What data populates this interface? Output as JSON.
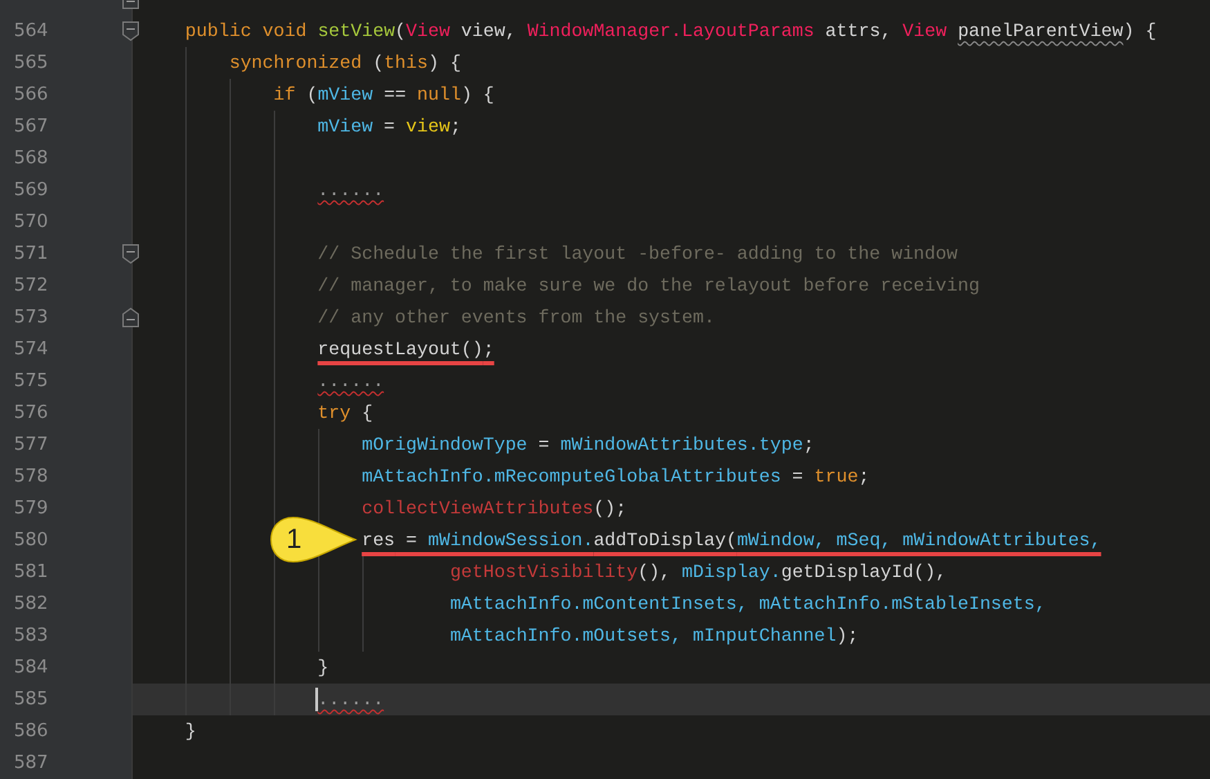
{
  "editor": {
    "lines": [
      {
        "fold_close": true
      },
      {
        "number": "564",
        "fold_open": true,
        "tokens": [
          {
            "kind": "keyword",
            "text": "    public void "
          },
          {
            "kind": "declaration",
            "text": "setView"
          },
          {
            "kind": "plain",
            "text": "("
          },
          {
            "kind": "type",
            "text": "View"
          },
          {
            "kind": "plain",
            "text": " view"
          },
          {
            "kind": "punct",
            "text": ", "
          },
          {
            "kind": "type",
            "text": "WindowManager.LayoutParams"
          },
          {
            "kind": "plain",
            "text": " attrs"
          },
          {
            "kind": "punct",
            "text": ", "
          },
          {
            "kind": "type",
            "text": "View "
          },
          {
            "kind": "plain",
            "text": "panelParentView",
            "unused": true
          },
          {
            "kind": "plain",
            "text": ") {"
          }
        ]
      },
      {
        "number": "565",
        "tokens": [
          {
            "kind": "keyword",
            "text": "        synchronized "
          },
          {
            "kind": "plain",
            "text": "("
          },
          {
            "kind": "keyword",
            "text": "this"
          },
          {
            "kind": "plain",
            "text": ") {"
          }
        ]
      },
      {
        "number": "566",
        "tokens": [
          {
            "kind": "keyword",
            "text": "            if "
          },
          {
            "kind": "plain",
            "text": "("
          },
          {
            "kind": "field",
            "text": "mView"
          },
          {
            "kind": "punct",
            "text": " == "
          },
          {
            "kind": "keyword",
            "text": "null"
          },
          {
            "kind": "plain",
            "text": ") {"
          }
        ]
      },
      {
        "number": "567",
        "tokens": [
          {
            "kind": "field",
            "text": "                mView"
          },
          {
            "kind": "punct",
            "text": " = "
          },
          {
            "kind": "local",
            "text": "view"
          },
          {
            "kind": "punct",
            "text": ";"
          }
        ]
      },
      {
        "number": "568"
      },
      {
        "number": "569",
        "tokens": [
          {
            "kind": "dim",
            "text": "                ......",
            "error": true
          }
        ]
      },
      {
        "number": "570"
      },
      {
        "number": "571",
        "fold_open": true,
        "tokens": [
          {
            "kind": "comment",
            "text": "                // Schedule the first layout -before- adding to the window"
          }
        ]
      },
      {
        "number": "572",
        "tokens": [
          {
            "kind": "comment",
            "text": "                // manager, to make sure we do the relayout before receiving"
          }
        ]
      },
      {
        "number": "573",
        "fold_close": true,
        "tokens": [
          {
            "kind": "comment",
            "text": "                // any other events from the system."
          }
        ]
      },
      {
        "number": "574",
        "underlined": true,
        "tokens": [
          {
            "kind": "plain",
            "text": "                requestLayout()"
          },
          {
            "kind": "punct",
            "text": ";"
          }
        ]
      },
      {
        "number": "575",
        "tokens": [
          {
            "kind": "dim",
            "text": "                ......",
            "error": true
          }
        ]
      },
      {
        "number": "576",
        "tokens": [
          {
            "kind": "keyword",
            "text": "                try "
          },
          {
            "kind": "plain",
            "text": "{"
          }
        ]
      },
      {
        "number": "577",
        "tokens": [
          {
            "kind": "field",
            "text": "                    mOrigWindowType"
          },
          {
            "kind": "punct",
            "text": " = "
          },
          {
            "kind": "field",
            "text": "mWindowAttributes.type"
          },
          {
            "kind": "punct",
            "text": ";"
          }
        ]
      },
      {
        "number": "578",
        "tokens": [
          {
            "kind": "field",
            "text": "                    mAttachInfo.mRecomputeGlobalAttributes"
          },
          {
            "kind": "punct",
            "text": " = "
          },
          {
            "kind": "keyword",
            "text": "true"
          },
          {
            "kind": "punct",
            "text": ";"
          }
        ]
      },
      {
        "number": "579",
        "tokens": [
          {
            "kind": "call",
            "text": "                    collectViewAttributes"
          },
          {
            "kind": "plain",
            "text": "()"
          },
          {
            "kind": "punct",
            "text": ";"
          }
        ]
      },
      {
        "number": "580",
        "underlined": true,
        "callout": "1",
        "tokens": [
          {
            "kind": "plain",
            "text": "                    res"
          },
          {
            "kind": "punct",
            "text": " = "
          },
          {
            "kind": "field",
            "text": "mWindowSession."
          },
          {
            "kind": "plain",
            "text": "addToDisplay("
          },
          {
            "kind": "field",
            "text": "mWindow, mSeq, mWindowAttributes,"
          }
        ]
      },
      {
        "number": "581",
        "tokens": [
          {
            "kind": "call",
            "text": "                            getHostVisibility"
          },
          {
            "kind": "plain",
            "text": "(), "
          },
          {
            "kind": "field",
            "text": "mDisplay."
          },
          {
            "kind": "plain",
            "text": "getDisplayId(),"
          }
        ]
      },
      {
        "number": "582",
        "tokens": [
          {
            "kind": "field",
            "text": "                            mAttachInfo.mContentInsets, mAttachInfo.mStableInsets,"
          }
        ]
      },
      {
        "number": "583",
        "tokens": [
          {
            "kind": "field",
            "text": "                            mAttachInfo.mOutsets, mInputChannel"
          },
          {
            "kind": "plain",
            "text": ");"
          }
        ]
      },
      {
        "number": "584",
        "tokens": [
          {
            "kind": "plain",
            "text": "                }"
          }
        ]
      },
      {
        "number": "585",
        "current": true,
        "tokens": [
          {
            "kind": "dim",
            "text": "                ......",
            "error": true
          }
        ]
      },
      {
        "number": "586",
        "tokens": [
          {
            "kind": "plain",
            "text": "    }"
          }
        ]
      },
      {
        "number": "587"
      }
    ]
  }
}
